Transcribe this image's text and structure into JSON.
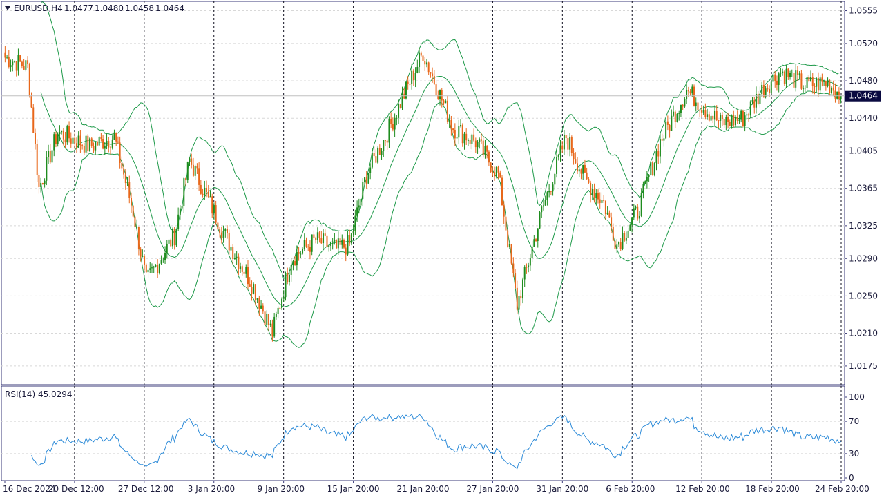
{
  "chart_window": {
    "symbol_header": "EURUSD,H4",
    "ohlc": {
      "open": "1.0477",
      "high": "1.0480",
      "low": "1.0458",
      "close": "1.0464"
    },
    "current_price_label": "1.0464",
    "colors": {
      "bull": "#1e8c1e",
      "bear": "#e8671a",
      "bands": "#1f9a4a",
      "rsi": "#2b8ad8",
      "grid": "#d8d8d8",
      "frame": "#3a3a7a",
      "vline": "#101020",
      "price_tag_bg": "#0a0a40"
    },
    "indicator": {
      "label": "RSI(14) 45.0294"
    }
  },
  "chart_data": [
    {
      "type": "candlestick",
      "title": "EURUSD,H4",
      "overlays": [
        "Bollinger Bands"
      ],
      "x_labels": [
        "16 Dec 2024",
        "20 Dec 12:00",
        "27 Dec 12:00",
        "3 Jan 20:00",
        "9 Jan 20:00",
        "15 Jan 20:00",
        "21 Jan 20:00",
        "27 Jan 20:00",
        "31 Jan 20:00",
        "6 Feb 20:00",
        "12 Feb 20:00",
        "18 Feb 20:00",
        "24 Feb 20:00"
      ],
      "y_ticks": [
        1.0555,
        1.052,
        1.048,
        1.044,
        1.0405,
        1.0365,
        1.0325,
        1.029,
        1.025,
        1.021,
        1.0175
      ],
      "ylim": [
        1.0155,
        1.0565
      ],
      "current_price": 1.0464,
      "grid": true,
      "session_separators": true
    },
    {
      "type": "line",
      "title": "RSI(14) 45.0294",
      "y_ticks": [
        100,
        70,
        30,
        0
      ],
      "ylim": [
        0,
        100
      ],
      "current_value": 45.0294,
      "grid": true
    }
  ]
}
